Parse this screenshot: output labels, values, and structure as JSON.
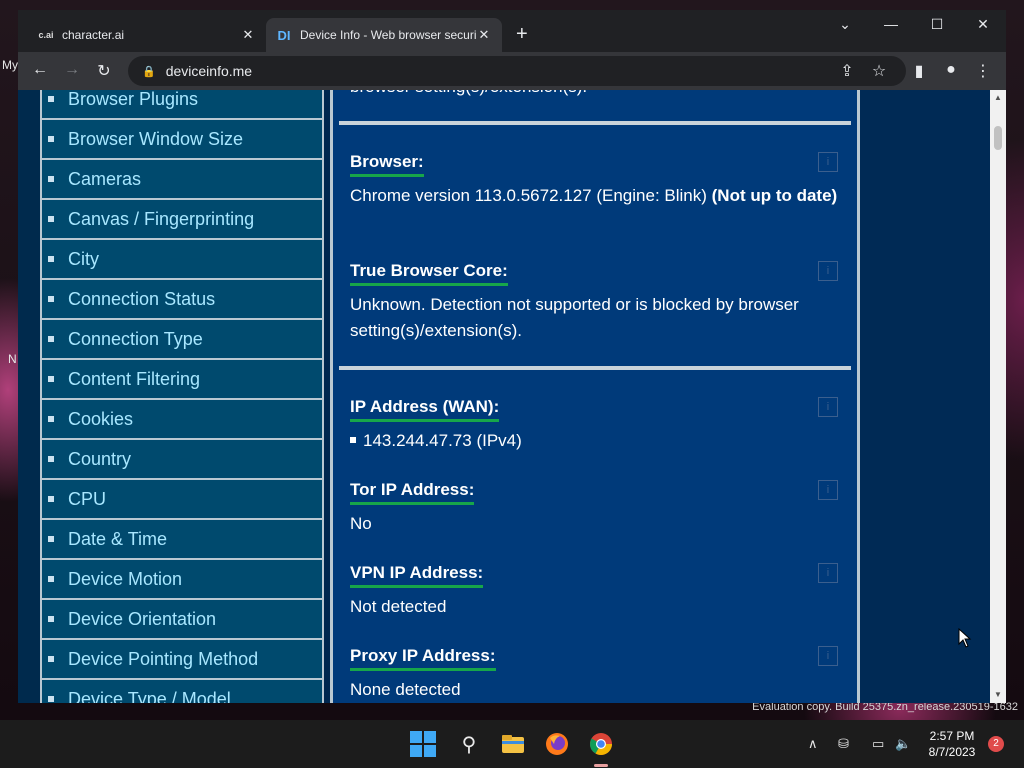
{
  "desktop": {
    "left_fragments": [
      "My",
      "N"
    ],
    "evaluation_text": "Evaluation copy. Build 25375.zn_release.230519-1632"
  },
  "browser": {
    "tabs": [
      {
        "label": "character.ai",
        "favicon": "c.ai"
      },
      {
        "label": "Device Info - Web browser security",
        "favicon": "DI"
      }
    ],
    "url": "deviceinfo.me"
  },
  "sidebar": {
    "items": [
      "Browser Plugins",
      "Browser Window Size",
      "Cameras",
      "Canvas / Fingerprinting",
      "City",
      "Connection Status",
      "Connection Type",
      "Content Filtering",
      "Cookies",
      "Country",
      "CPU",
      "Date & Time",
      "Device Motion",
      "Device Orientation",
      "Device Pointing Method",
      "Device Type / Model"
    ]
  },
  "content": {
    "top_fragment": "browser setting(s)/extension(s).",
    "browser": {
      "label": "Browser:",
      "value": "Chrome version 113.0.5672.127 (Engine: Blink) ",
      "status": "(Not up to date)"
    },
    "true_core": {
      "label": "True Browser Core:",
      "value": "Unknown. Detection not supported or is blocked by browser setting(s)/extension(s)."
    },
    "ip_wan": {
      "label": "IP Address (WAN):",
      "value": "143.244.47.73  (IPv4)"
    },
    "tor_ip": {
      "label": "Tor IP Address:",
      "value": "No"
    },
    "vpn_ip": {
      "label": "VPN IP Address:",
      "value": "Not detected"
    },
    "proxy_ip": {
      "label": "Proxy IP Address:",
      "value": "None detected"
    },
    "info_glyph": "i"
  },
  "taskbar": {
    "time": "2:57 PM",
    "date": "8/7/2023",
    "notifications": "2"
  },
  "colors": {
    "page_bg": "#00274f",
    "nav_bg": "#004a6e",
    "nav_text": "#a8e7ff",
    "content_bg": "#003a7a",
    "label_underline": "#17a64a"
  }
}
